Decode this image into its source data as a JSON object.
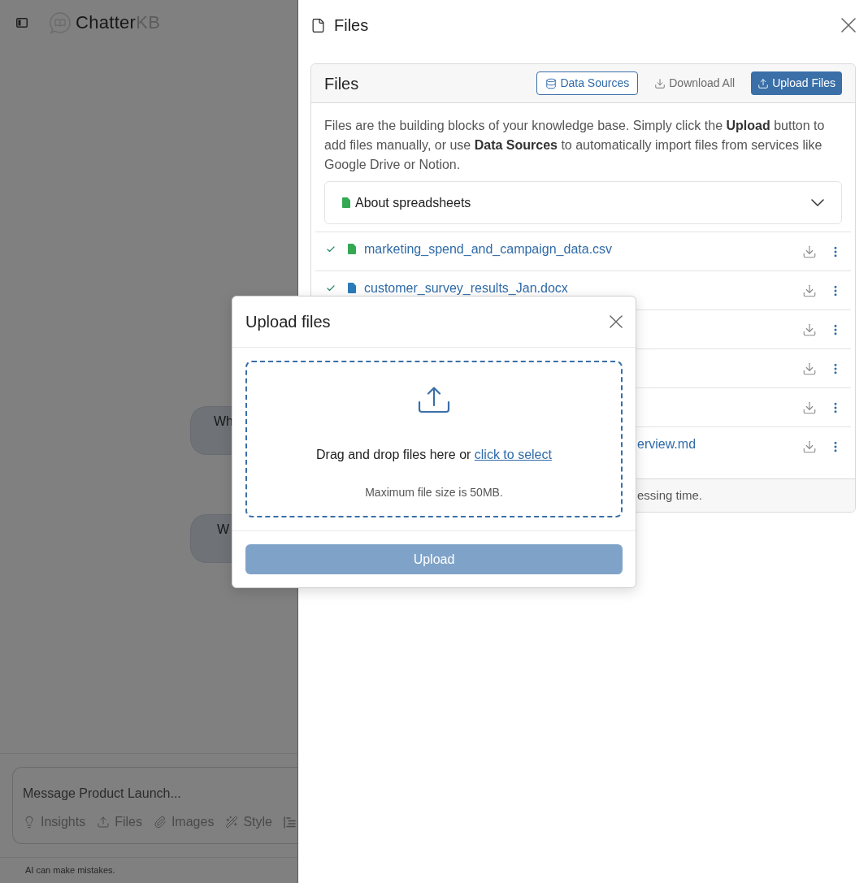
{
  "app": {
    "logo": {
      "name": "Chatter",
      "suffix": "KB"
    },
    "messages": [
      {
        "text": "Wh"
      },
      {
        "text": "W"
      }
    ],
    "composer": {
      "placeholder": "Message Product Launch...",
      "tools": [
        {
          "label": "Insights"
        },
        {
          "label": "Files"
        },
        {
          "label": "Images"
        },
        {
          "label": "Style"
        }
      ]
    },
    "disclaimer": "AI can make mistakes."
  },
  "files_panel": {
    "title": "Files",
    "card": {
      "title": "Files",
      "actions": [
        {
          "label": "Data Sources",
          "kind": "outline"
        },
        {
          "label": "Download All",
          "kind": "link"
        },
        {
          "label": "Upload Files",
          "kind": "primary"
        }
      ],
      "intro": "Files are the building blocks of your knowledge base. Simply click the **Upload** button to add files manually, or use **Data Sources** to automatically import files from services like Google Drive or Notion.",
      "accordion": {
        "label": "About spreadsheets",
        "expanded": false
      },
      "files": [
        {
          "kind": "sheet",
          "done": true,
          "name": "marketing_spend_and_campaign_data.csv"
        },
        {
          "kind": "doc",
          "done": true,
          "name": "customer_survey_results_Jan.docx"
        },
        {
          "kind": "covered"
        },
        {
          "kind": "covered"
        },
        {
          "kind": "covered"
        },
        {
          "kind": "covered",
          "name": "erview.md"
        }
      ],
      "footer_note": "essing time."
    }
  },
  "upload_dialog": {
    "title": "Upload files",
    "dropzone": {
      "text": "Drag and drop files here or",
      "link": "click to select",
      "note": "Maximum file size is 50MB."
    },
    "button": {
      "label": "Upload",
      "disabled": true
    }
  }
}
